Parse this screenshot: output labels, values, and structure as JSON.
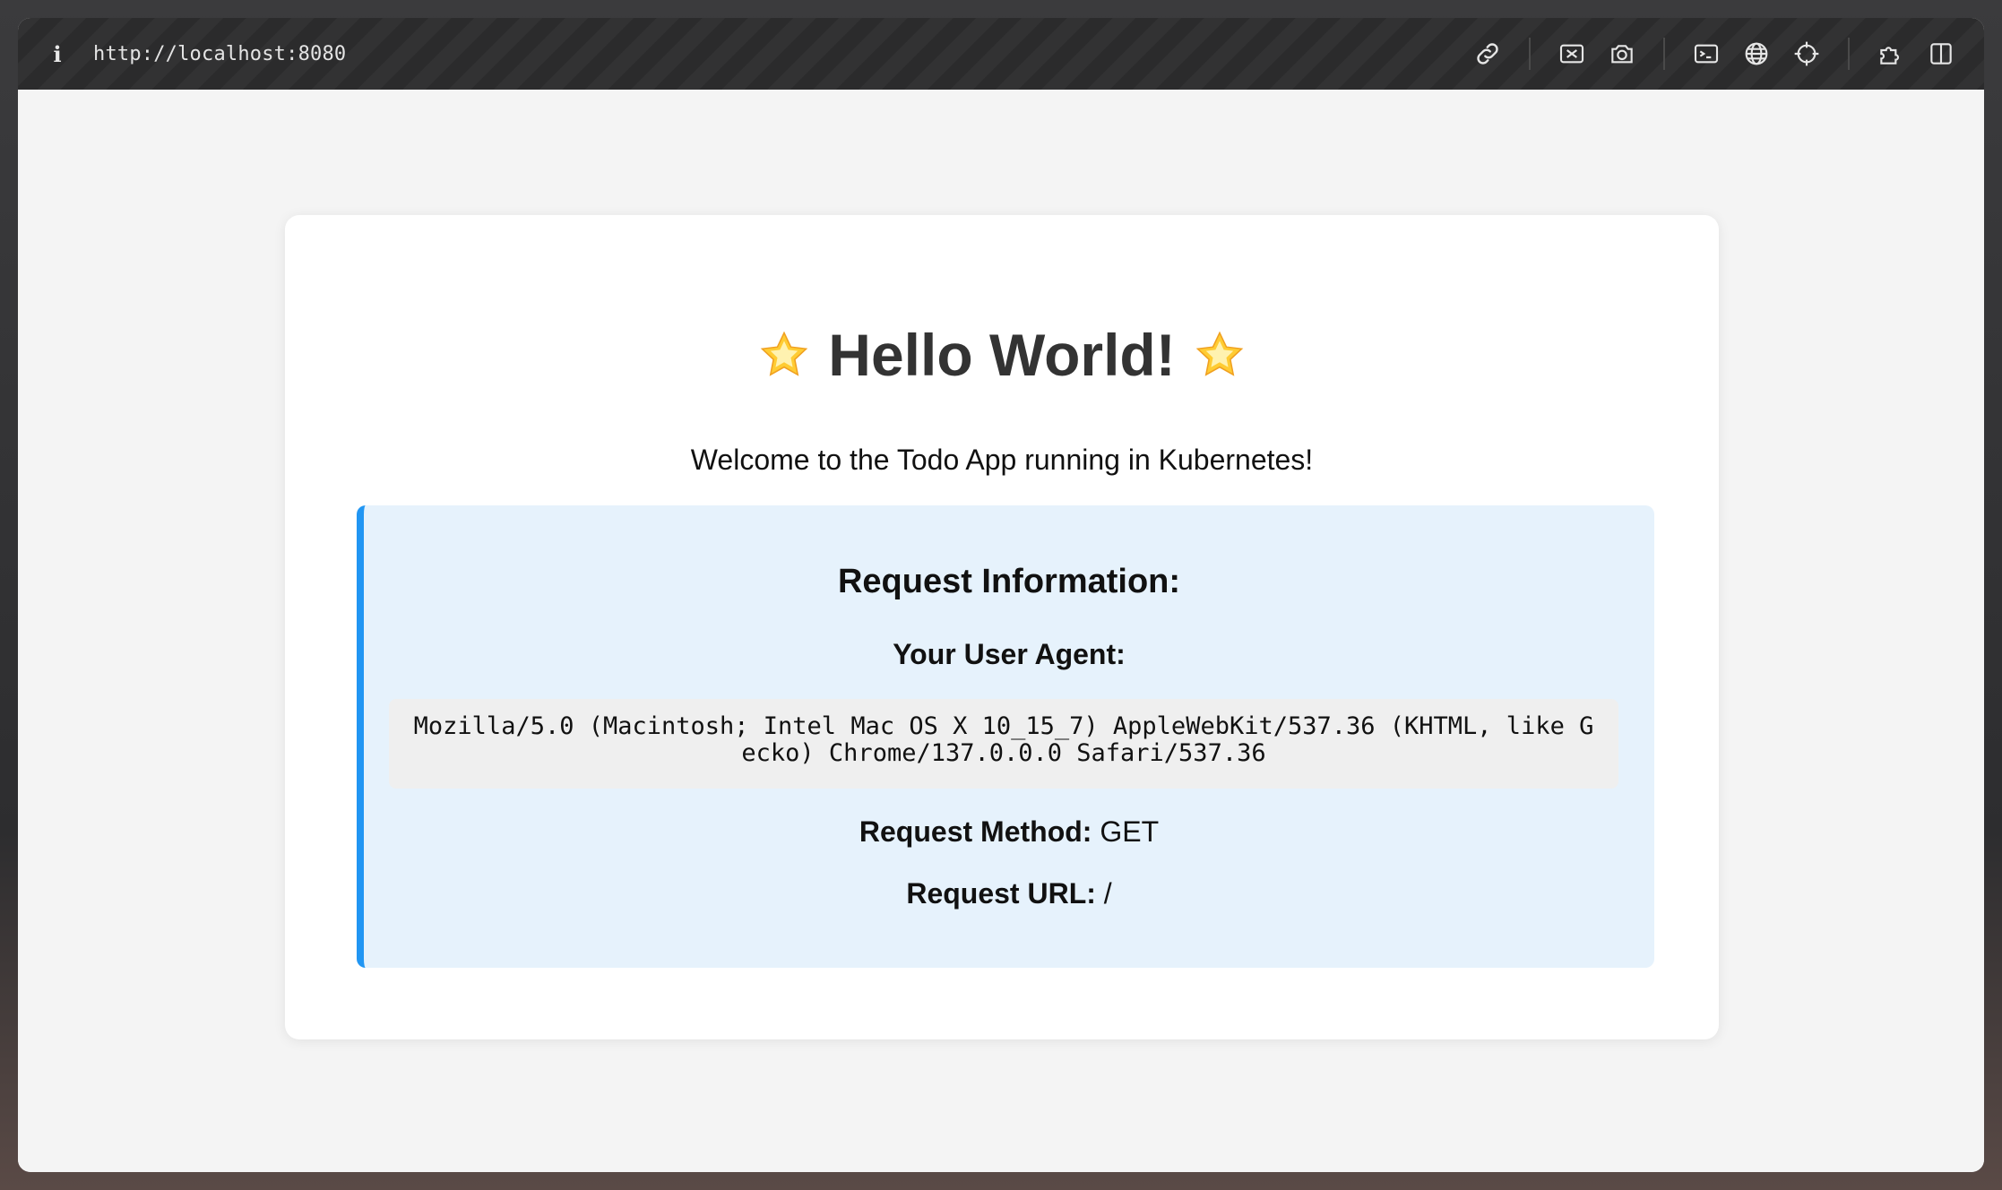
{
  "browser": {
    "url": "http://localhost:8080",
    "info_icon": "info-icon",
    "tools": [
      {
        "name": "link-icon"
      },
      {
        "name": "screenshot-area-icon"
      },
      {
        "name": "camera-icon"
      },
      {
        "name": "terminal-icon"
      },
      {
        "name": "globe-icon"
      },
      {
        "name": "crosshair-icon"
      },
      {
        "name": "extensions-icon"
      },
      {
        "name": "split-view-icon"
      }
    ]
  },
  "page": {
    "title": "Hello World!",
    "title_icon": "glowing-star-icon",
    "subtitle": "Welcome to the Todo App running in Kubernetes!",
    "info": {
      "heading": "Request Information:",
      "ua_label": "Your User Agent:",
      "ua_value": "Mozilla/5.0 (Macintosh; Intel Mac OS X 10_15_7) AppleWebKit/537.36 (KHTML, like Gecko) Chrome/137.0.0.0 Safari/537.36",
      "method_label": "Request Method:",
      "method_value": "GET",
      "url_label": "Request URL:",
      "url_value": "/"
    }
  },
  "colors": {
    "accent": "#2196f3",
    "info_bg": "#e6f2fc",
    "page_bg": "#f4f4f4",
    "title": "#333333"
  }
}
